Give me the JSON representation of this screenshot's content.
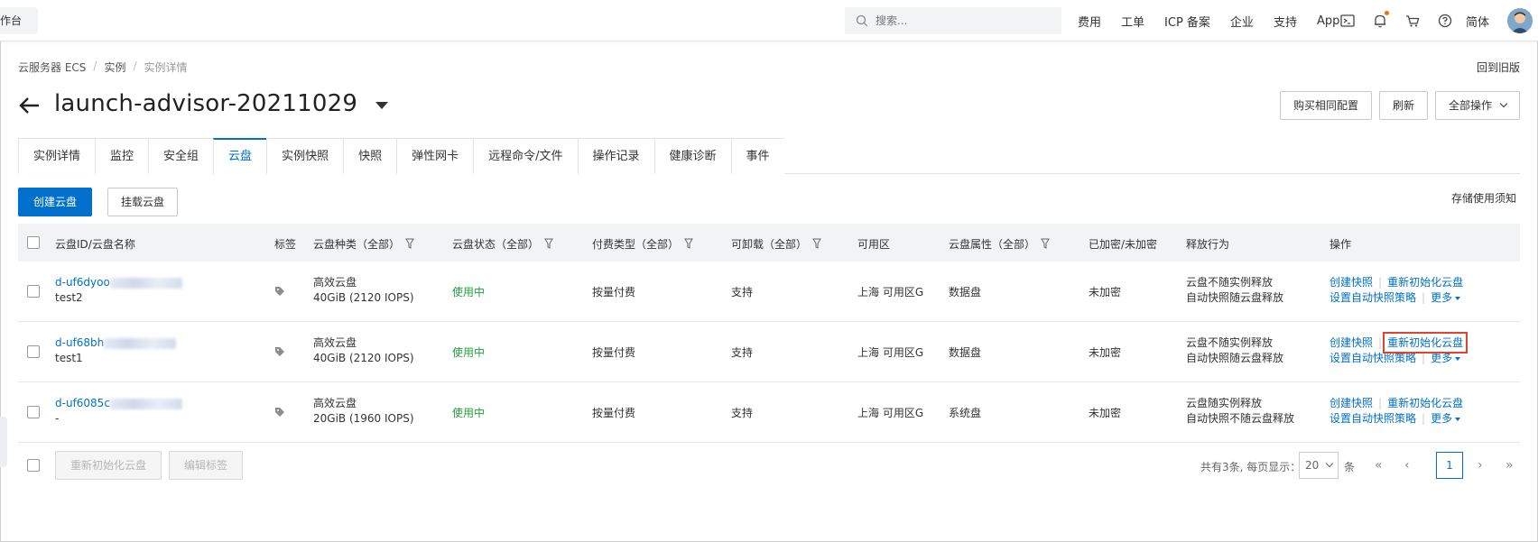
{
  "topbar": {
    "workbench": "工作台",
    "search_placeholder": "搜索...",
    "links": [
      "费用",
      "工单",
      "ICP 备案",
      "企业",
      "支持",
      "App"
    ],
    "language": "简体"
  },
  "breadcrumb": [
    "云服务器 ECS",
    "实例",
    "实例详情"
  ],
  "back_to_old": "回到旧版",
  "title": "launch-advisor-20211029",
  "header_buttons": {
    "buy_same": "购买相同配置",
    "refresh": "刷新",
    "all_actions": "全部操作"
  },
  "tabs": [
    "实例详情",
    "监控",
    "安全组",
    "云盘",
    "实例快照",
    "快照",
    "弹性网卡",
    "远程命令/文件",
    "操作记录",
    "健康诊断",
    "事件"
  ],
  "active_tab": "云盘",
  "toolbar": {
    "create_disk": "创建云盘",
    "mount_disk": "挂载云盘",
    "storage_note": "存储使用须知"
  },
  "table": {
    "headers": {
      "disk": "云盘ID/云盘名称",
      "tags": "标签",
      "type": "云盘种类（全部）",
      "status": "云盘状态（全部）",
      "billing": "付费类型（全部）",
      "detachable": "可卸载（全部）",
      "zone": "可用区",
      "attr": "云盘属性（全部）",
      "encrypted": "已加密/未加密",
      "release": "释放行为",
      "ops": "操作"
    },
    "rows": [
      {
        "id": "d-uf6dyoo",
        "name": "test2",
        "type": "高效云盘",
        "spec": "40GiB (2120 IOPS)",
        "status": "使用中",
        "billing": "按量付费",
        "detachable": "支持",
        "zone": "上海 可用区G",
        "attr": "数据盘",
        "encrypted": "未加密",
        "release1": "云盘不随实例释放",
        "release2": "自动快照随云盘释放"
      },
      {
        "id": "d-uf68bh",
        "name": "test1",
        "type": "高效云盘",
        "spec": "40GiB (2120 IOPS)",
        "status": "使用中",
        "billing": "按量付费",
        "detachable": "支持",
        "zone": "上海 可用区G",
        "attr": "数据盘",
        "encrypted": "未加密",
        "release1": "云盘不随实例释放",
        "release2": "自动快照随云盘释放"
      },
      {
        "id": "d-uf6085c",
        "name": "-",
        "type": "高效云盘",
        "spec": "20GiB (1960 IOPS)",
        "status": "使用中",
        "billing": "按量付费",
        "detachable": "支持",
        "zone": "上海 可用区G",
        "attr": "系统盘",
        "encrypted": "未加密",
        "release1": "云盘随实例释放",
        "release2": "自动快照不随云盘释放"
      }
    ],
    "ops": {
      "create_snapshot": "创建快照",
      "reinit": "重新初始化云盘",
      "auto_snapshot": "设置自动快照策略",
      "more": "更多"
    }
  },
  "footer": {
    "reinit_disk": "重新初始化云盘",
    "edit_tags": "编辑标签",
    "total_text": "共有3条, 每页显示：",
    "page_size": "20",
    "unit": "条",
    "first": "«",
    "prev": "‹",
    "current_page": "1",
    "next": "›",
    "last": "»"
  },
  "colors": {
    "primary": "#0070cc",
    "status_green": "#1fa33b",
    "highlight": "#e0452b"
  }
}
